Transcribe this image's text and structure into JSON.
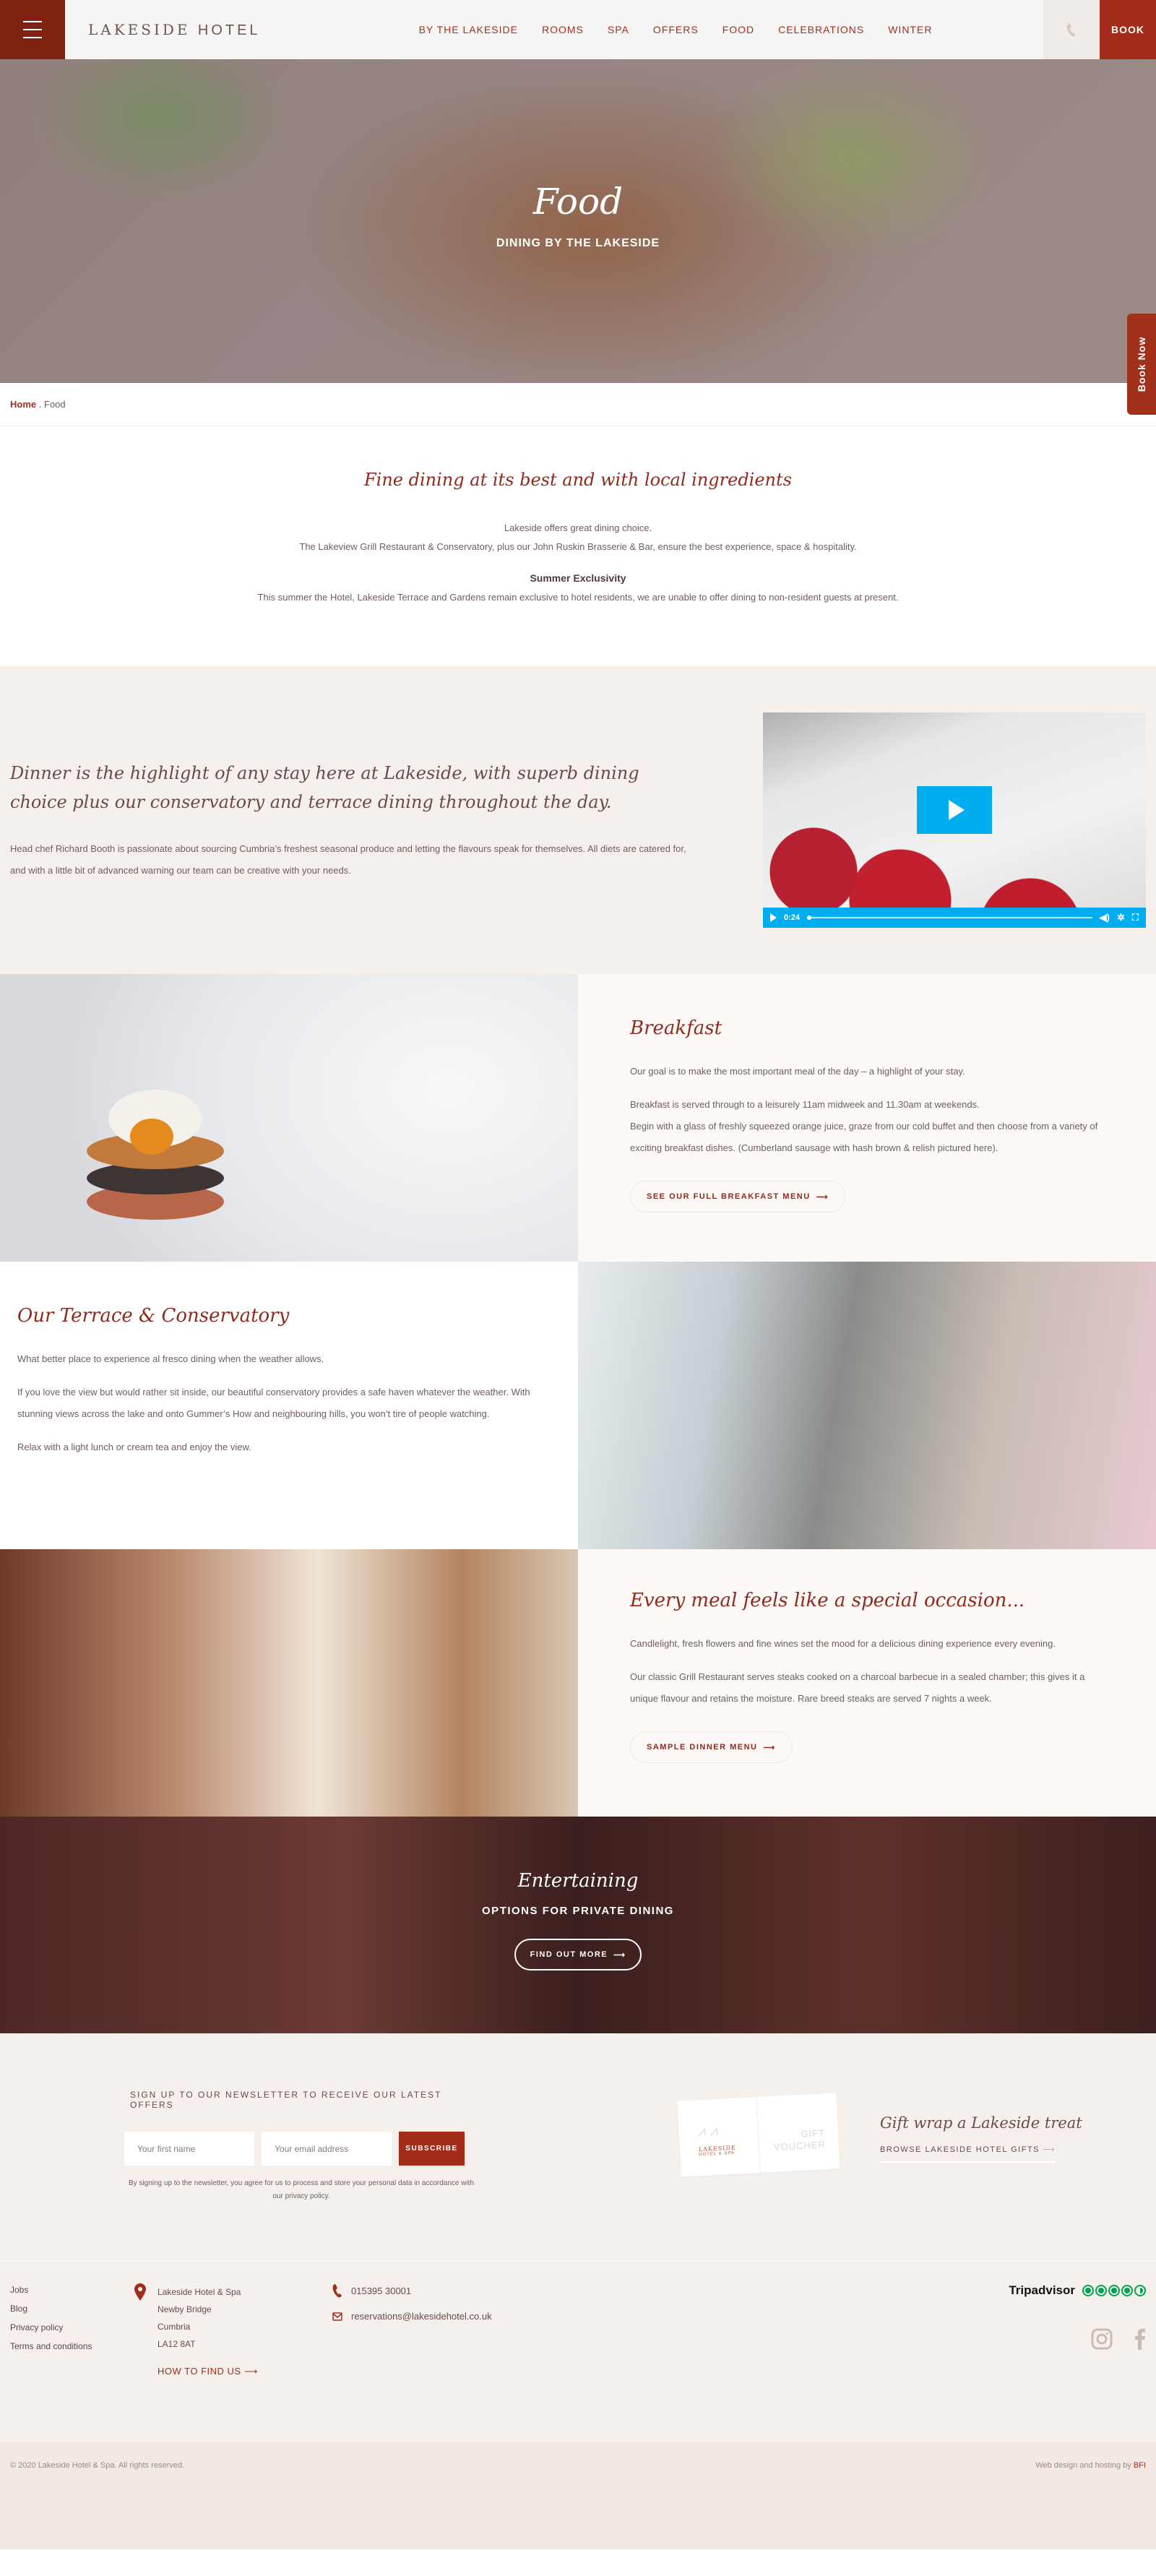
{
  "header": {
    "logo_main": "LAKESIDE",
    "logo_secondary": "HOTEL",
    "nav": [
      "BY THE LAKESIDE",
      "ROOMS",
      "SPA",
      "OFFERS",
      "FOOD",
      "CELEBRATIONS",
      "WINTER"
    ],
    "book_label": "BOOK"
  },
  "hero": {
    "title": "Food",
    "subtitle": "DINING BY THE LAKESIDE",
    "book_now": "Book Now"
  },
  "breadcrumb": {
    "home": "Home",
    "separator": ".",
    "current": "Food"
  },
  "intro": {
    "heading": "Fine dining at its best and with local ingredients",
    "p1": "Lakeside offers great dining choice.",
    "p2": "The Lakeview Grill Restaurant & Conservatory, plus our John Ruskin Brasserie & Bar, ensure the best experience, space & hospitality.",
    "subheading": "Summer Exclusivity",
    "p3": "This summer the Hotel, Lakeside Terrace and Gardens remain exclusive to hotel residents, we are unable to offer dining to non-resident guests at present."
  },
  "dinner": {
    "heading": "Dinner is the highlight of any stay here at Lakeside, with superb dining choice plus our conservatory and terrace dining throughout the day.",
    "body": "Head chef Richard Booth is passionate about sourcing Cumbria’s freshest seasonal produce and letting the flavours speak for themselves. All diets are catered for, and with a little bit of advanced warning our team can be creative with your needs.",
    "video": {
      "time": "0:24",
      "progress": 0.0
    }
  },
  "breakfast": {
    "heading": "Breakfast",
    "p1": "Our goal is to make the most important meal of the day – a highlight of your stay.",
    "p2": "Breakfast is served through to a leisurely 11am midweek and 11.30am at weekends.",
    "p3": "Begin with a glass of freshly squeezed orange juice, graze from our cold buffet and then choose from a variety of exciting breakfast dishes. (Cumberland sausage with hash brown & relish pictured here).",
    "cta": "SEE OUR FULL BREAKFAST MENU"
  },
  "terrace": {
    "heading": "Our Terrace & Conservatory",
    "p1": "What better place to experience al fresco dining when the weather allows.",
    "p2": "If you love the view but would rather sit inside, our beautiful conservatory provides a safe haven whatever the weather. With stunning views across the lake and onto Gummer’s How and neighbouring hills, you won’t tire of people watching.",
    "p3": "Relax with a light lunch or cream tea and enjoy the view."
  },
  "occasion": {
    "heading": "Every meal feels like a special occasion...",
    "p1": "Candlelight, fresh flowers and fine wines set the mood for a delicious dining experience every evening.",
    "p2": "Our classic Grill Restaurant serves steaks cooked on a charcoal barbecue in a sealed chamber; this gives it a unique flavour and retains the moisture. Rare breed steaks are served 7 nights a week.",
    "cta": "SAMPLE DINNER MENU"
  },
  "entertaining": {
    "heading": "Entertaining",
    "subtitle": "OPTIONS FOR PRIVATE DINING",
    "cta": "FIND OUT MORE"
  },
  "newsletter": {
    "title": "SIGN UP TO OUR NEWSLETTER TO RECEIVE OUR LATEST OFFERS",
    "first_name_placeholder": "Your first name",
    "email_placeholder": "Your email address",
    "subscribe": "SUBSCRIBE",
    "legal": "By signing up to the newsletter, you agree for us to process and store your personal data in accordance with our privacy policy."
  },
  "gift": {
    "voucher_brand": "LAKESIDE",
    "voucher_brand2": "HOTEL & SPA",
    "voucher_label1": "GIFT",
    "voucher_label2": "VOUCHER",
    "heading": "Gift wrap a Lakeside treat",
    "link": "BROWSE LAKESIDE HOTEL GIFTS"
  },
  "footer": {
    "links": [
      "Jobs",
      "Blog",
      "Privacy policy",
      "Terms and conditions"
    ],
    "address": [
      "Lakeside Hotel & Spa",
      "Newby Bridge",
      "Cumbria",
      "LA12 8AT"
    ],
    "find_us": "HOW TO FIND US",
    "phone": "015395 30001",
    "email": "reservations@lakesidehotel.co.uk",
    "tripadvisor": "Tripadvisor",
    "rating": 4.5,
    "copyright": "© 2020 Lakeside Hotel & Spa. All rights reserved.",
    "credit": "Web design and hosting by",
    "credit_link": "BFI"
  },
  "colors": {
    "brand": "#a12d1a",
    "brand_dark": "#802312",
    "accent_video": "#00adef",
    "tripadvisor": "#00a450"
  }
}
